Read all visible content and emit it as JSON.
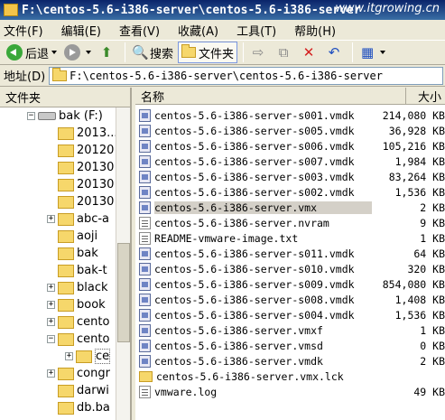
{
  "window": {
    "title": "F:\\centos-5.6-i386-server\\centos-5.6-i386-server",
    "watermark": "www.itgrowing.cn"
  },
  "menu": [
    "文件(F)",
    "编辑(E)",
    "查看(V)",
    "收藏(A)",
    "工具(T)",
    "帮助(H)"
  ],
  "toolbar": {
    "back_label": "后退",
    "search_label": "搜索",
    "folders_label": "文件夹"
  },
  "address": {
    "label": "地址(D)",
    "value": "F:\\centos-5.6-i386-server\\centos-5.6-i386-server"
  },
  "folder_pane": {
    "title": "文件夹",
    "items": [
      {
        "label": "bak (F:)",
        "expander": "−",
        "type": "drive"
      },
      {
        "label": "2013...",
        "expander": "",
        "type": "folder"
      },
      {
        "label": "20120",
        "expander": "",
        "type": "folder"
      },
      {
        "label": "20130",
        "expander": "",
        "type": "folder"
      },
      {
        "label": "20130",
        "expander": "",
        "type": "folder"
      },
      {
        "label": "20130",
        "expander": "",
        "type": "folder"
      },
      {
        "label": "abc-a",
        "expander": "+",
        "type": "folder"
      },
      {
        "label": "aoji",
        "expander": "",
        "type": "folder"
      },
      {
        "label": "bak",
        "expander": "",
        "type": "folder"
      },
      {
        "label": "bak-t",
        "expander": "",
        "type": "folder"
      },
      {
        "label": "black",
        "expander": "+",
        "type": "folder"
      },
      {
        "label": "book",
        "expander": "+",
        "type": "folder"
      },
      {
        "label": "cento",
        "expander": "+",
        "type": "folder"
      },
      {
        "label": "cento",
        "expander": "−",
        "type": "folder"
      },
      {
        "label": "ce",
        "expander": "+",
        "type": "folder",
        "selected": true
      },
      {
        "label": "congr",
        "expander": "+",
        "type": "folder"
      },
      {
        "label": "darwi",
        "expander": "",
        "type": "folder"
      },
      {
        "label": "db.ba",
        "expander": "",
        "type": "folder"
      }
    ]
  },
  "file_pane": {
    "columns": {
      "name": "名称",
      "size": "大小"
    },
    "files": [
      {
        "name": "centos-5.6-i386-server-s001.vmdk",
        "size": "214,080 KB",
        "icon": "vmdk-icon"
      },
      {
        "name": "centos-5.6-i386-server-s005.vmdk",
        "size": "36,928 KB",
        "icon": "vmdk-icon"
      },
      {
        "name": "centos-5.6-i386-server-s006.vmdk",
        "size": "105,216 KB",
        "icon": "vmdk-icon"
      },
      {
        "name": "centos-5.6-i386-server-s007.vmdk",
        "size": "1,984 KB",
        "icon": "vmdk-icon"
      },
      {
        "name": "centos-5.6-i386-server-s003.vmdk",
        "size": "83,264 KB",
        "icon": "vmdk-icon"
      },
      {
        "name": "centos-5.6-i386-server-s002.vmdk",
        "size": "1,536 KB",
        "icon": "vmdk-icon"
      },
      {
        "name": "centos-5.6-i386-server.vmx",
        "size": "2 KB",
        "icon": "vmx-icon",
        "selected": true
      },
      {
        "name": "centos-5.6-i386-server.nvram",
        "size": "9 KB",
        "icon": "nvram-icon"
      },
      {
        "name": "README-vmware-image.txt",
        "size": "1 KB",
        "icon": "text-file-icon"
      },
      {
        "name": "centos-5.6-i386-server-s011.vmdk",
        "size": "64 KB",
        "icon": "vmdk-icon"
      },
      {
        "name": "centos-5.6-i386-server-s010.vmdk",
        "size": "320 KB",
        "icon": "vmdk-icon"
      },
      {
        "name": "centos-5.6-i386-server-s009.vmdk",
        "size": "854,080 KB",
        "icon": "vmdk-icon"
      },
      {
        "name": "centos-5.6-i386-server-s008.vmdk",
        "size": "1,408 KB",
        "icon": "vmdk-icon"
      },
      {
        "name": "centos-5.6-i386-server-s004.vmdk",
        "size": "1,536 KB",
        "icon": "vmdk-icon"
      },
      {
        "name": "centos-5.6-i386-server.vmxf",
        "size": "1 KB",
        "icon": "vmxf-icon"
      },
      {
        "name": "centos-5.6-i386-server.vmsd",
        "size": "0 KB",
        "icon": "vmsd-icon"
      },
      {
        "name": "centos-5.6-i386-server.vmdk",
        "size": "2 KB",
        "icon": "vmdk-icon"
      },
      {
        "name": "centos-5.6-i386-server.vmx.lck",
        "size": "",
        "icon": "folder-icon"
      },
      {
        "name": "vmware.log",
        "size": "49 KB",
        "icon": "text-file-icon"
      }
    ]
  }
}
